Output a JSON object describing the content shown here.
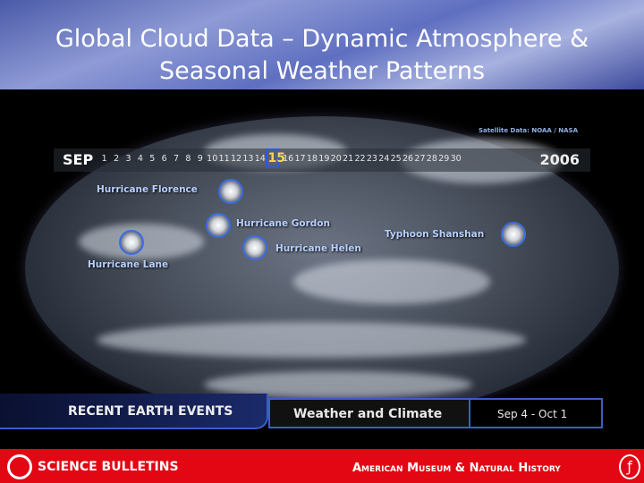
{
  "title": "Global Cloud Data – Dynamic Atmosphere & Seasonal Weather Patterns",
  "satellite_credit": "Satellite Data: NOAA / NASA",
  "timeline": {
    "month": "SEP",
    "year": "2006",
    "days": [
      "1",
      "2",
      "3",
      "4",
      "5",
      "6",
      "7",
      "8",
      "9",
      "10",
      "11",
      "12",
      "13",
      "14",
      "15",
      "16",
      "17",
      "18",
      "19",
      "20",
      "21",
      "22",
      "23",
      "24",
      "25",
      "26",
      "27",
      "28",
      "29",
      "30"
    ],
    "selected_day": "15"
  },
  "storms": [
    {
      "name": "Hurricane Florence"
    },
    {
      "name": "Hurricane Gordon"
    },
    {
      "name": "Hurricane Helen"
    },
    {
      "name": "Hurricane Lane"
    },
    {
      "name": "Typhoon Shanshan"
    }
  ],
  "events_bar": {
    "label": "RECENT EARTH EVENTS",
    "category": "Weather and Climate",
    "range": "Sep 4 - Oct 1"
  },
  "footer": {
    "left": "SCIENCE BULLETINS",
    "right": "American Museum & Natural History"
  }
}
